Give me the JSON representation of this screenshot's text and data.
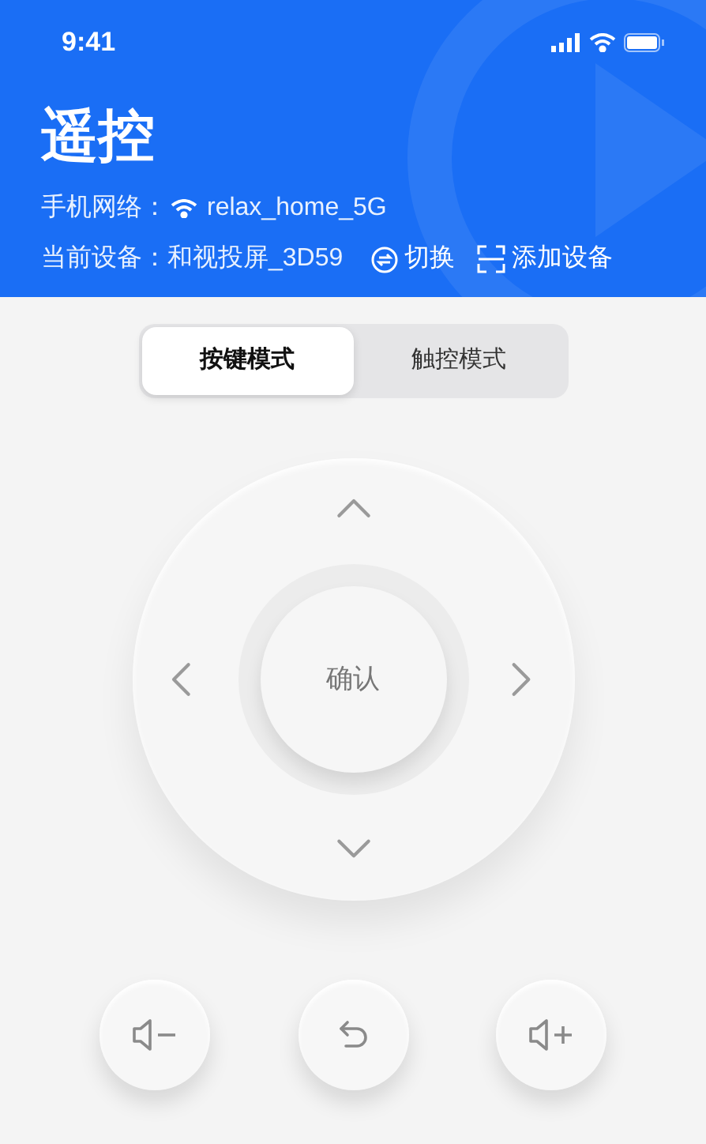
{
  "status_bar": {
    "time": "9:41"
  },
  "header": {
    "title": "遥控",
    "network_label": "手机网络：",
    "network_name": "relax_home_5G",
    "device_label": "当前设备：",
    "device_name": "和视投屏_3D59",
    "switch_label": "切换",
    "add_label": "添加设备"
  },
  "tabs": [
    {
      "label": "按键模式",
      "selected": true
    },
    {
      "label": "触控模式",
      "selected": false
    }
  ],
  "dpad": {
    "ok_label": "确认"
  }
}
